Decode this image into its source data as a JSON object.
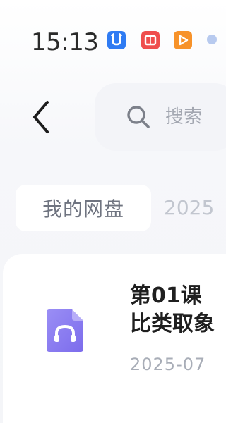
{
  "status_bar": {
    "time": "15:13",
    "notification_icons": [
      "alarm-app-icon",
      "mail-app-icon",
      "video-app-icon"
    ]
  },
  "header": {
    "search_placeholder": "搜索"
  },
  "breadcrumb": {
    "root": "我的网盘",
    "next": "2025"
  },
  "files": [
    {
      "title_line1": "第01课",
      "title_line2": "比类取象",
      "date": "2025-07",
      "type_icon": "audio-file-icon"
    }
  ],
  "colors": {
    "accent_purple": "#8b7cf0",
    "status_blue": "#2f7bf3",
    "status_red": "#ef4d4d",
    "status_orange": "#f7922a"
  }
}
